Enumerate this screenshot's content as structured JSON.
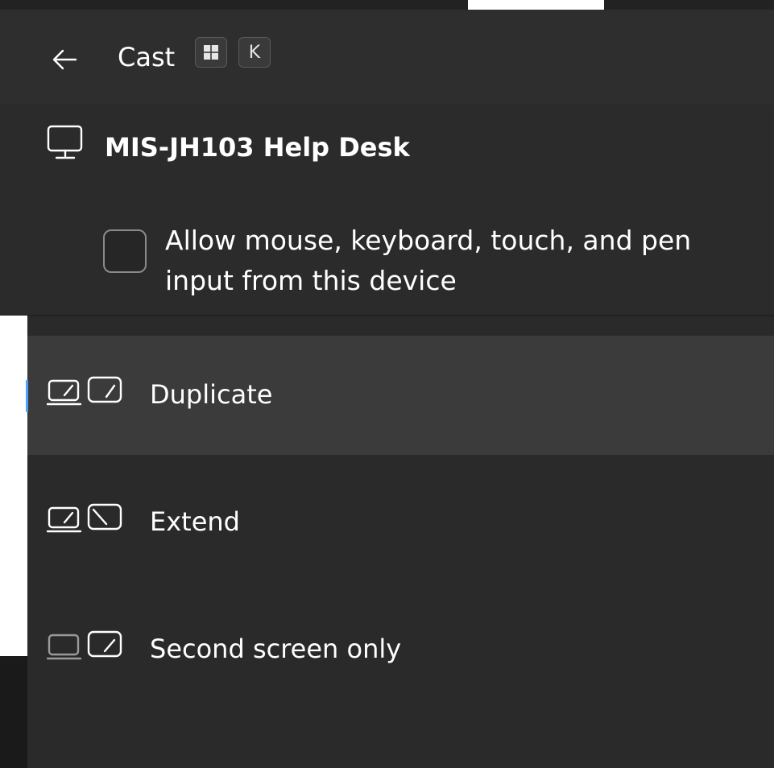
{
  "header": {
    "title": "Cast",
    "shortcut_keys": [
      "⊞",
      "K"
    ]
  },
  "device": {
    "name": "MIS-JH103 Help Desk"
  },
  "input_permission": {
    "label": "Allow mouse, keyboard, touch, and pen input from this device",
    "checked": false
  },
  "modes": [
    {
      "label": "Duplicate",
      "icon": "duplicate-mode-icon",
      "selected": true
    },
    {
      "label": "Extend",
      "icon": "extend-mode-icon",
      "selected": false
    },
    {
      "label": "Second screen only",
      "icon": "second-screen-only-icon",
      "selected": false
    }
  ],
  "colors": {
    "panel": "#2a2a2a",
    "selected": "#3b3b3b",
    "accent": "#4aa3ff"
  }
}
